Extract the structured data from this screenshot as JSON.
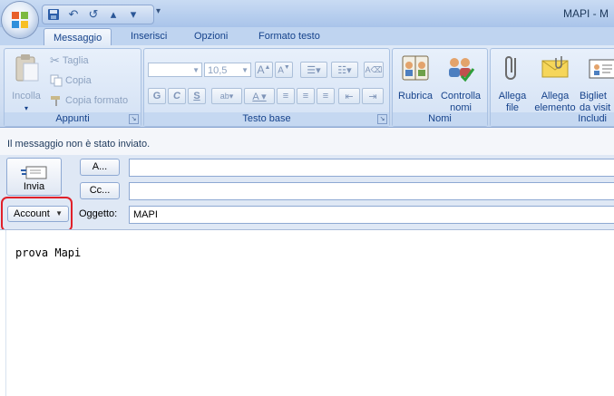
{
  "window": {
    "title": "MAPI - M"
  },
  "tabs": [
    {
      "label": "Messaggio",
      "active": true
    },
    {
      "label": "Inserisci"
    },
    {
      "label": "Opzioni"
    },
    {
      "label": "Formato testo"
    }
  ],
  "ribbon": {
    "appunti": {
      "label": "Appunti",
      "paste": "Incolla",
      "cut": "Taglia",
      "copy": "Copia",
      "format_painter": "Copia formato"
    },
    "testo_base": {
      "label": "Testo base",
      "font_size": "10,5",
      "bold": "G",
      "italic": "C",
      "underline": "S"
    },
    "nomi": {
      "label": "Nomi",
      "address_book": "Rubrica",
      "check_names_l1": "Controlla",
      "check_names_l2": "nomi"
    },
    "includi": {
      "label": "Includi",
      "attach_file_l1": "Allega",
      "attach_file_l2": "file",
      "attach_item_l1": "Allega",
      "attach_item_l2": "elemento",
      "business_card_l1": "Bigliet",
      "business_card_l2": "da visit"
    }
  },
  "infobar": {
    "text": "Il messaggio non è stato inviato."
  },
  "compose": {
    "send": "Invia",
    "to_button": "A...",
    "cc_button": "Cc...",
    "to_value": "",
    "cc_value": "",
    "account": "Account",
    "subject_label": "Oggetto:",
    "subject_value": "MAPI",
    "body": "prova Mapi"
  },
  "colors": {
    "highlight": "#e0202a",
    "ribbon_text": "#15428b"
  }
}
